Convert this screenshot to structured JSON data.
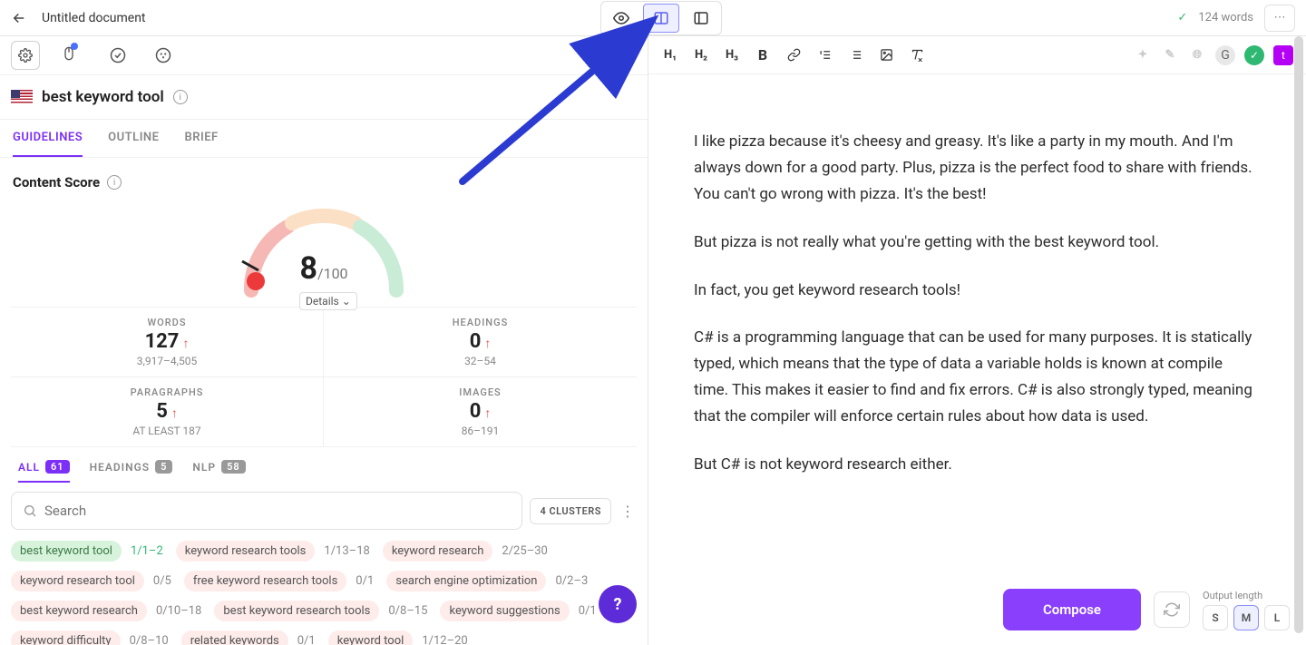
{
  "header": {
    "doc_title": "Untitled document",
    "word_count": "124 words"
  },
  "sidebar": {
    "keyword": "best keyword tool",
    "tabs": {
      "guidelines": "GUIDELINES",
      "outline": "OUTLINE",
      "brief": "BRIEF"
    },
    "content_score_label": "Content Score",
    "score": "8",
    "score_denom": "/100",
    "details_label": "Details",
    "stats": {
      "words_label": "WORDS",
      "words_value": "127",
      "words_range": "3,917–4,505",
      "headings_label": "HEADINGS",
      "headings_value": "0",
      "headings_range": "32–54",
      "paragraphs_label": "PARAGRAPHS",
      "paragraphs_value": "5",
      "paragraphs_range": "AT LEAST 187",
      "images_label": "IMAGES",
      "images_value": "0",
      "images_range": "86–191"
    },
    "kw_tabs": {
      "all_label": "ALL",
      "all_count": "61",
      "headings_label": "HEADINGS",
      "headings_count": "5",
      "nlp_label": "NLP",
      "nlp_count": "58"
    },
    "search_placeholder": "Search",
    "clusters_btn": "4 CLUSTERS",
    "chips": [
      {
        "label": "best keyword tool",
        "count": "1/1–2",
        "done": true,
        "count_green": true
      },
      {
        "label": "keyword research tools",
        "count": "1/13–18"
      },
      {
        "label": "keyword research",
        "count": "2/25–30"
      },
      {
        "label": "keyword research tool",
        "count": "0/5"
      },
      {
        "label": "free keyword research tools",
        "count": "0/1"
      },
      {
        "label": "search engine optimization",
        "count": "0/2–3"
      },
      {
        "label": "best keyword research",
        "count": "0/10–18"
      },
      {
        "label": "best keyword research tools",
        "count": "0/8–15"
      },
      {
        "label": "keyword suggestions",
        "count": "0/1"
      },
      {
        "label": "keyword difficulty",
        "count": "0/8–10"
      },
      {
        "label": "related keywords",
        "count": "0/1"
      },
      {
        "label": "keyword tool",
        "count": "1/12–20"
      }
    ]
  },
  "editor": {
    "p1": "I like pizza because it's cheesy and greasy. It's like a party in my mouth. And I'm always down for a good party. Plus, pizza is the perfect food to share with friends. You can't go wrong with pizza. It's the best!",
    "p2": "But pizza is not really what you're getting with the best keyword tool.",
    "p3": "In fact, you get keyword research tools!",
    "p4": "C# is a programming language that can be used for many purposes. It is statically typed, which means that the type of data a variable holds is known at compile time. This makes it easier to find and fix errors. C# is also strongly typed, meaning that the compiler will enforce certain rules about how data is used.",
    "p5": "But C# is not keyword research either."
  },
  "compose": {
    "btn": "Compose",
    "length_label": "Output length",
    "s": "S",
    "m": "M",
    "l": "L"
  },
  "toolbar": {
    "h1": "H₁",
    "h2": "H₂",
    "h3": "H₃"
  }
}
